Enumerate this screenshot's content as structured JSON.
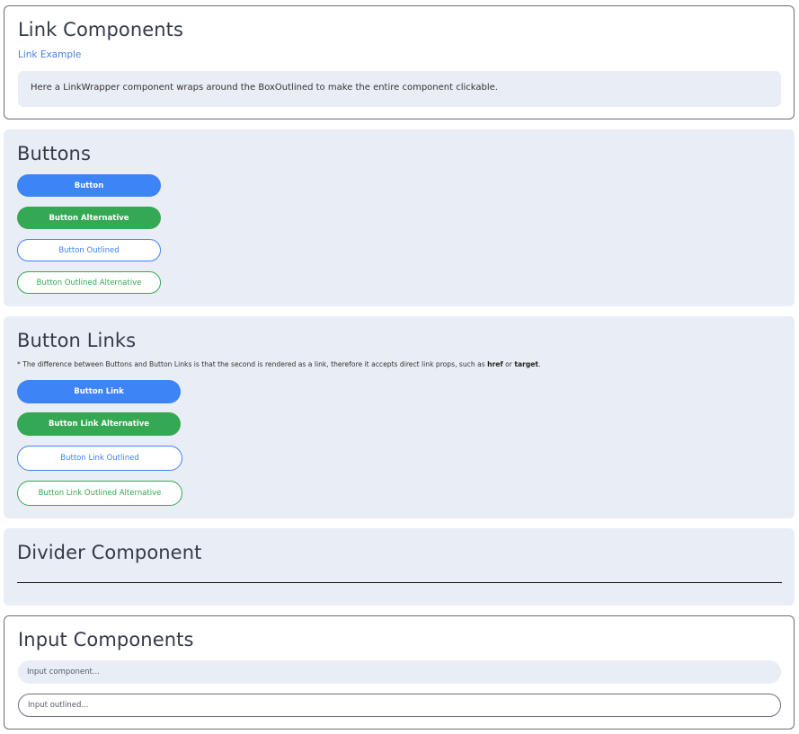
{
  "link_section": {
    "title": "Link Components",
    "link_label": "Link Example",
    "wrapper_text": "Here a LinkWrapper component wraps around the BoxOutlined to make the entire component clickable."
  },
  "buttons_section": {
    "title": "Buttons",
    "button": "Button",
    "button_alt": "Button Alternative",
    "button_outlined": "Button Outlined",
    "button_outlined_alt": "Button Outlined Alternative"
  },
  "button_links_section": {
    "title": "Button Links",
    "note_prefix": "* The difference between Buttons and Button Links is that the second is rendered as a link, therefore it accepts direct link props, such as",
    "note_href": "href",
    "note_or": "or",
    "note_target": "target",
    "note_end": ".",
    "button_link": "Button Link",
    "button_link_alt": "Button Link Alternative",
    "button_link_outlined": "Button Link Outlined",
    "button_link_outlined_alt": "Button Link Outlined Alternative"
  },
  "divider_section": {
    "title": "Divider Component"
  },
  "input_section": {
    "title": "Input Components",
    "input_placeholder": "Input component...",
    "input_outlined_placeholder": "Input outlined..."
  },
  "colors": {
    "primary": "#3d84f6",
    "alternative": "#34a853",
    "box_background": "#e9edf5",
    "border": "#6b6f78"
  }
}
